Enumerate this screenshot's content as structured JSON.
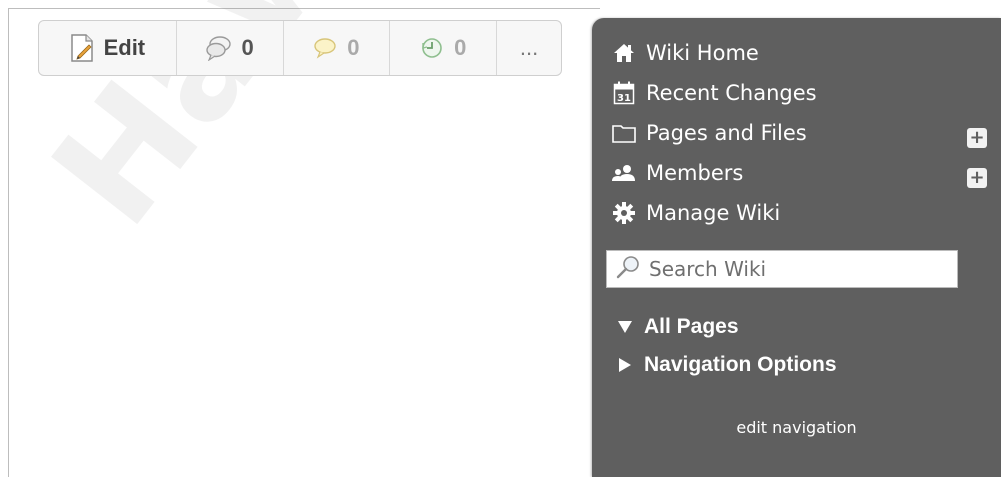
{
  "toolbar": {
    "edit_label": "Edit",
    "buttons": [
      {
        "icon": "discussion-icon",
        "count": "0"
      },
      {
        "icon": "comment-icon",
        "count": "0"
      },
      {
        "icon": "history-icon",
        "count": "0"
      }
    ],
    "more_label": "..."
  },
  "sidebar": {
    "items": [
      {
        "label": "Wiki Home",
        "icon": "home-icon"
      },
      {
        "label": "Recent Changes",
        "icon": "calendar-icon"
      },
      {
        "label": "Pages and Files",
        "icon": "folder-icon",
        "has_add": true
      },
      {
        "label": "Members",
        "icon": "members-icon",
        "has_add": true
      },
      {
        "label": "Manage Wiki",
        "icon": "gear-icon"
      }
    ],
    "add_label": "+",
    "calendar_day": "31",
    "search": {
      "placeholder": "Search Wiki",
      "value": ""
    },
    "tree": [
      {
        "label": "All Pages",
        "expanded": true
      },
      {
        "label": "Navigation Options",
        "expanded": false
      }
    ],
    "edit_navigation_label": "edit navigation"
  },
  "watermark": "Hawker",
  "colors": {
    "sidebar_bg": "#5f5f5f",
    "toolbar_bg": "#f7f7f7",
    "text_light": "#ffffff"
  }
}
